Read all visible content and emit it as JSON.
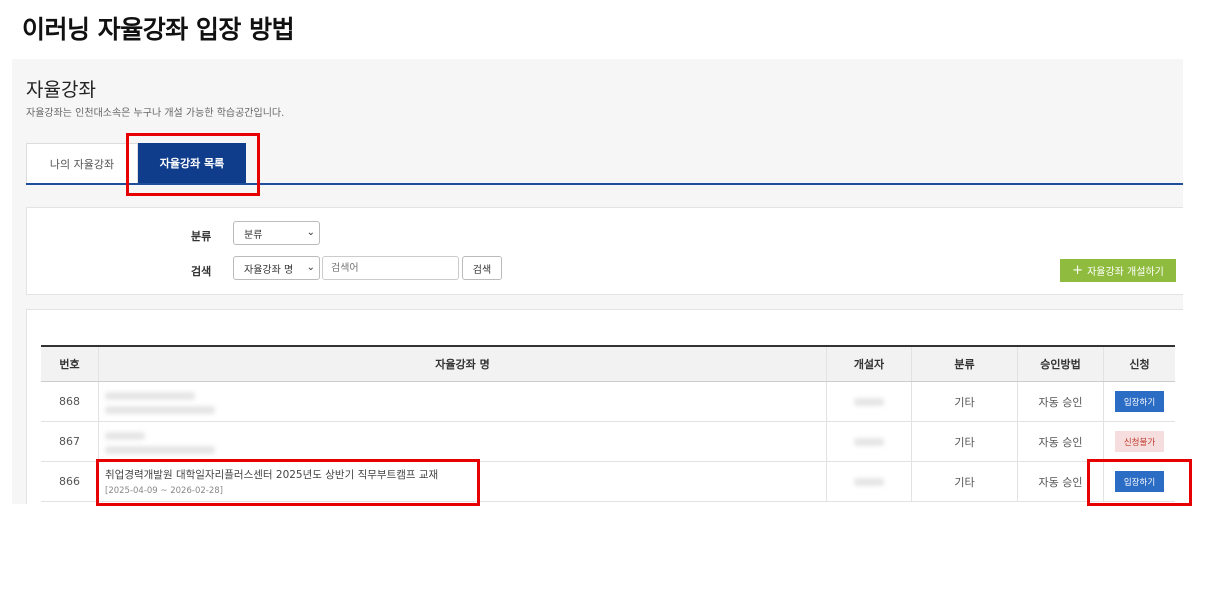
{
  "heading": "이러닝 자율강좌 입장 방법",
  "page": {
    "title": "자율강좌",
    "description": "자율강좌는 인천대소속은 누구나 개설 가능한 학습공간입니다."
  },
  "tabs": [
    {
      "label": "나의 자율강좌",
      "active": false
    },
    {
      "label": "자율강좌 목록",
      "active": true
    }
  ],
  "search": {
    "category_label": "분류",
    "category_selected": "분류",
    "search_label": "검색",
    "field_selected": "자율강좌 명",
    "placeholder": "검색어",
    "search_button": "검색",
    "create_button": "자율강좌 개설하기"
  },
  "table": {
    "headers": [
      "번호",
      "자율강좌 명",
      "개설자",
      "분류",
      "승인방법",
      "신청"
    ],
    "rows": [
      {
        "no": "868",
        "title": "",
        "period": "",
        "creator": "",
        "category": "기타",
        "approval": "자동 승인",
        "action": "입장하기",
        "action_type": "enter",
        "blurred": true
      },
      {
        "no": "867",
        "title": "",
        "period": "",
        "creator": "",
        "category": "기타",
        "approval": "자동 승인",
        "action": "신청불가",
        "action_type": "disabled",
        "blurred": true
      },
      {
        "no": "866",
        "title": "취업경력개발원 대학일자리플러스센터 2025년도 상반기 직무부트캠프 교재",
        "period": "[2025-04-09 ~ 2026-02-28]",
        "creator": "",
        "category": "기타",
        "approval": "자동 승인",
        "action": "입장하기",
        "action_type": "enter",
        "blurred": false
      }
    ]
  },
  "colors": {
    "tab_active": "#0f3d8c",
    "create_button": "#8fbc3e",
    "enter_button": "#2b6cc4",
    "disabled_button_bg": "#f7dede",
    "highlight": "#e60000"
  }
}
